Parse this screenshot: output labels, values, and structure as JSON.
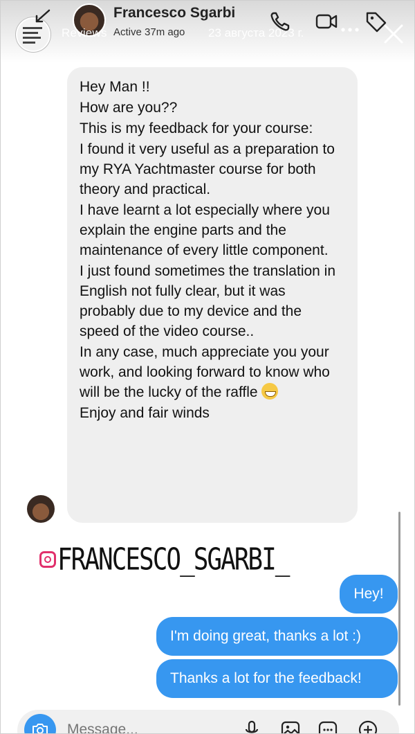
{
  "story": {
    "title": "Reviews",
    "date": "23 августа 2023 г."
  },
  "header": {
    "name": "Francesco Sgarbi",
    "status": "Active 37m ago"
  },
  "message_in": {
    "lines": [
      "Hey Man !!",
      "How are you??",
      "This is my feedback for your course:",
      "I found it very useful as a preparation to my RYA Yachtmaster course for both theory and practical.",
      "I have learnt a lot especially where you explain  the engine parts and the maintenance of every little component.",
      "I just found sometimes the translation in English not fully clear, but it was probably due to my device and the speed of the video course..",
      "In any case, much appreciate you your work, and looking forward to know who will be the lucky of the raffle",
      "Enjoy and fair winds"
    ]
  },
  "watermark": {
    "handle": "FRANCESCO_SGARBI_"
  },
  "messages_out": [
    {
      "text": "Hey!"
    },
    {
      "text": "I'm doing great, thanks a lot :)"
    },
    {
      "text": "Thanks a lot for the feedback!"
    }
  ],
  "composer": {
    "placeholder": "Message..."
  },
  "colors": {
    "outgoing_bubble": "#3797f0",
    "incoming_bubble": "#efefef",
    "instagram_accent": "#e1306c"
  },
  "icons": [
    "back-icon",
    "phone-icon",
    "video-icon",
    "tag-icon",
    "more-icon",
    "close-icon",
    "camera-icon",
    "mic-icon",
    "gallery-icon",
    "sticker-icon",
    "plus-icon",
    "grin-emoji-icon",
    "instagram-icon"
  ]
}
